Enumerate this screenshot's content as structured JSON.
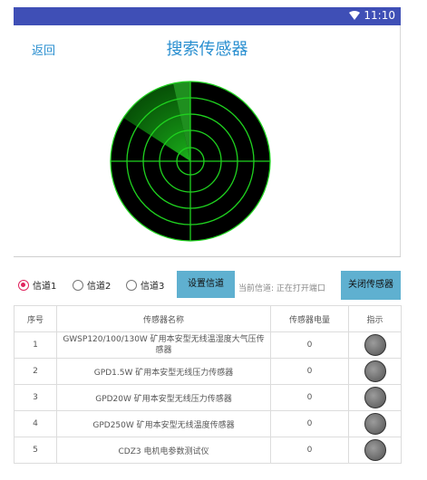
{
  "status_bar": {
    "time": "11:10",
    "wifi_icon": "wifi-icon"
  },
  "header": {
    "back_label": "返回",
    "title": "搜索传感器"
  },
  "controls": {
    "channels": [
      {
        "label": "信道1",
        "selected": true
      },
      {
        "label": "信道2",
        "selected": false
      },
      {
        "label": "信道3",
        "selected": false
      }
    ],
    "set_channel_label": "设置信道",
    "current_channel_text": "当前信道: 正在打开端口",
    "close_sensor_label": "关闭传感器"
  },
  "table": {
    "headers": [
      "序号",
      "传感器名称",
      "传感器电量",
      "指示"
    ],
    "rows": [
      {
        "index": "1",
        "name": "GWSP120/100/130W 矿用本安型无线温湿度大气压传感器",
        "power": "0"
      },
      {
        "index": "2",
        "name": "GPD1.5W 矿用本安型无线压力传感器",
        "power": "0"
      },
      {
        "index": "3",
        "name": "GPD20W 矿用本安型无线压力传感器",
        "power": "0"
      },
      {
        "index": "4",
        "name": "GPD250W 矿用本安型无线温度传感器",
        "power": "0"
      },
      {
        "index": "5",
        "name": "CDZ3 电机电参数测试仪",
        "power": "0"
      }
    ]
  },
  "colors": {
    "accent": "#2a8fd0",
    "status_bar": "#3f4fb6",
    "button": "#5fb0d0",
    "radar_green": "#22dd22"
  }
}
